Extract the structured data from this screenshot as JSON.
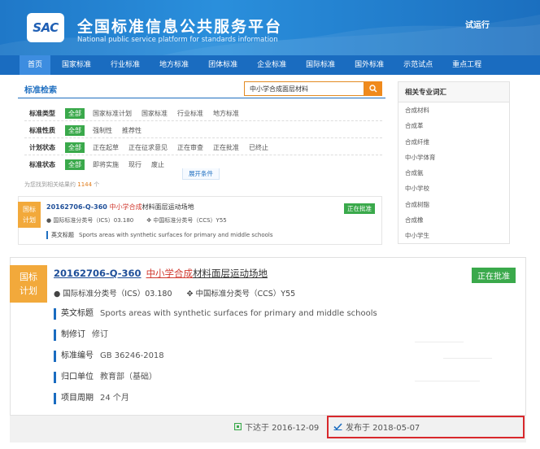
{
  "header": {
    "logo_text": "SAC",
    "title": "全国标准信息公共服务平台",
    "subtitle": "National public service platform  for standards information",
    "trial": "试运行"
  },
  "nav": [
    "首页",
    "国家标准",
    "行业标准",
    "地方标准",
    "团体标准",
    "企业标准",
    "国际标准",
    "国外标准",
    "示范试点",
    "重点工程"
  ],
  "search": {
    "label": "标准检索",
    "query": "中小学合成面层材料"
  },
  "filters": [
    {
      "label": "标准类型",
      "all": "全部",
      "options": [
        "国家标准计划",
        "国家标准",
        "行业标准",
        "地方标准"
      ]
    },
    {
      "label": "标准性质",
      "all": "全部",
      "options": [
        "强制性",
        "推荐性"
      ]
    },
    {
      "label": "计划状态",
      "all": "全部",
      "options": [
        "正在起草",
        "正在征求意见",
        "正在审查",
        "正在批准",
        "已终止"
      ]
    },
    {
      "label": "标准状态",
      "all": "全部",
      "options": [
        "即将实施",
        "现行",
        "废止"
      ]
    }
  ],
  "expand_label": "展开条件",
  "found": {
    "prefix": "为您找到相关结果约",
    "count": "1144",
    "suffix": "个"
  },
  "sidebar": {
    "title": "相关专业词汇",
    "items": [
      "合成材料",
      "合成革",
      "合成纤维",
      "中小学体育",
      "合成氨",
      "中小学校",
      "合成树脂",
      "合成橡",
      "中小学生"
    ]
  },
  "result_small": {
    "tag_line1": "国标",
    "tag_line2": "计划",
    "code": "20162706-Q-360",
    "title_red": "中小学合成",
    "title_rest": "材料面层运动场地",
    "ics": "国际标准分类号（ICS）03.180",
    "ccs": "中国标准分类号（CCS）Y55",
    "status": "正在批准",
    "en_label": "英文标题",
    "en_title": "Sports areas with synthetic surfaces for primary and middle schools"
  },
  "result_large": {
    "tag_line1": "国标",
    "tag_line2": "计划",
    "code": "20162706-Q-360",
    "title_red": "中小学合成",
    "title_rest": "材料面层运动场地",
    "ics": "国际标准分类号（ICS）03.180",
    "ccs": "中国标准分类号（CCS）Y55",
    "status": "正在批准",
    "rows": [
      {
        "label": "英文标题",
        "value": "Sports areas with synthetic surfaces for primary and middle schools"
      },
      {
        "label": "制修订",
        "value": "修订"
      },
      {
        "label": "标准编号",
        "value": "GB 36246-2018"
      },
      {
        "label": "归口单位",
        "value": "教育部（基础）"
      },
      {
        "label": "项目周期",
        "value": "24 个月"
      }
    ],
    "issued": "下达于 2016-12-09",
    "published": "发布于 2018-05-07"
  },
  "colors": {
    "brand_blue": "#1a6cc0",
    "badge_green": "#3aa94b",
    "tag_orange": "#f2a93b",
    "highlight_red": "#d0382e",
    "box_red": "#d8282c"
  }
}
